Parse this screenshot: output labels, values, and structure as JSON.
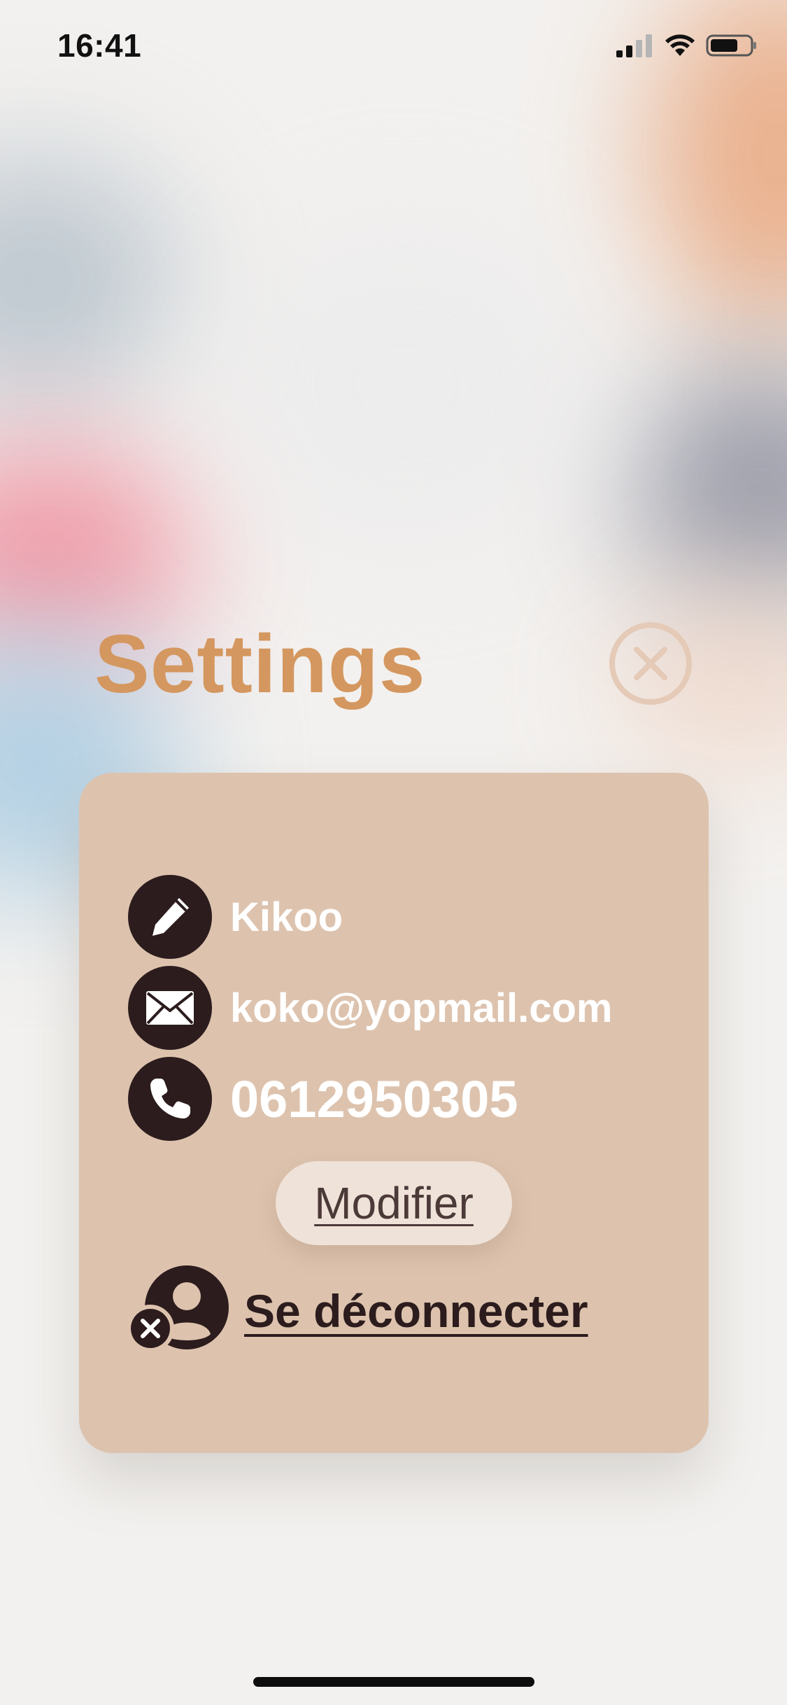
{
  "status_bar": {
    "time": "16:41",
    "icons": [
      "signal-icon",
      "wifi-icon",
      "battery-icon"
    ]
  },
  "header": {
    "title": "Settings",
    "close_icon": "close-circle-icon"
  },
  "profile": {
    "name": "Kikoo",
    "email": "koko@yopmail.com",
    "phone": "0612950305",
    "name_icon": "pencil-icon",
    "email_icon": "envelope-icon",
    "phone_icon": "phone-icon"
  },
  "actions": {
    "modify_label": "Modifier",
    "logout_label": "Se déconnecter",
    "logout_icon": "user-remove-icon"
  },
  "colors": {
    "accent": "#d4975f",
    "card": "#ddc3ae",
    "icon_bg": "#2c1c1d",
    "button_bg": "#efe2d8"
  }
}
